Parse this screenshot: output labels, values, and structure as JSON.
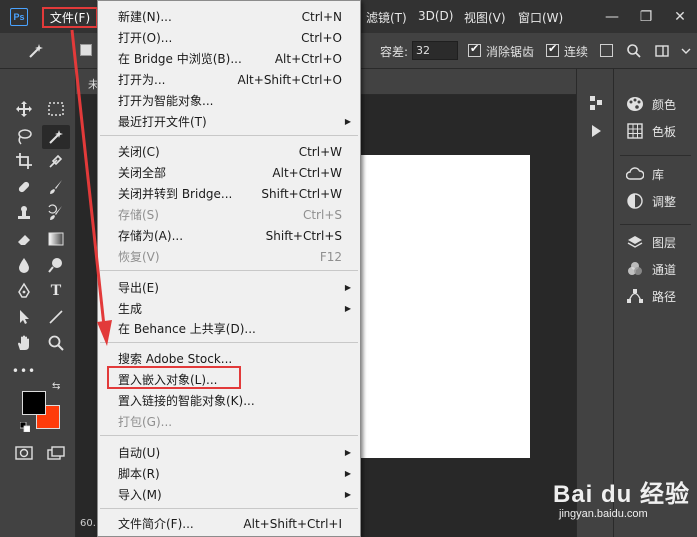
{
  "app": {
    "logo": "Ps"
  },
  "menubar": {
    "file": "文件(F)",
    "filter": "滤镜(T)",
    "three_d": "3D(D)",
    "view": "视图(V)",
    "window": "窗口(W)",
    "win_minimize": "—",
    "win_restore": "❐",
    "win_close": "✕"
  },
  "options": {
    "tolerance_label": "容差:",
    "tolerance_value": "32",
    "antialias_label": "消除锯齿",
    "contiguous_label": "连续"
  },
  "document": {
    "tab_label": "未",
    "zoom": "60."
  },
  "file_menu": {
    "items": [
      {
        "label": "新建(N)...",
        "shortcut": "Ctrl+N"
      },
      {
        "label": "打开(O)...",
        "shortcut": "Ctrl+O"
      },
      {
        "label": "在 Bridge 中浏览(B)...",
        "shortcut": "Alt+Ctrl+O"
      },
      {
        "label": "打开为...",
        "shortcut": "Alt+Shift+Ctrl+O"
      },
      {
        "label": "打开为智能对象...",
        "shortcut": ""
      },
      {
        "label": "最近打开文件(T)",
        "shortcut": "",
        "submenu": true
      },
      {
        "label": "关闭(C)",
        "shortcut": "Ctrl+W"
      },
      {
        "label": "关闭全部",
        "shortcut": "Alt+Ctrl+W"
      },
      {
        "label": "关闭并转到 Bridge...",
        "shortcut": "Shift+Ctrl+W"
      },
      {
        "label": "存储(S)",
        "shortcut": "Ctrl+S",
        "disabled": true
      },
      {
        "label": "存储为(A)...",
        "shortcut": "Shift+Ctrl+S"
      },
      {
        "label": "恢复(V)",
        "shortcut": "F12",
        "disabled": true
      },
      {
        "label": "导出(E)",
        "shortcut": "",
        "submenu": true
      },
      {
        "label": "生成",
        "shortcut": "",
        "submenu": true
      },
      {
        "label": "在 Behance 上共享(D)...",
        "shortcut": ""
      },
      {
        "label": "搜索 Adobe Stock...",
        "shortcut": ""
      },
      {
        "label": "置入嵌入对象(L)...",
        "shortcut": ""
      },
      {
        "label": "置入链接的智能对象(K)...",
        "shortcut": ""
      },
      {
        "label": "打包(G)...",
        "shortcut": "",
        "disabled": true
      },
      {
        "label": "自动(U)",
        "shortcut": "",
        "submenu": true
      },
      {
        "label": "脚本(R)",
        "shortcut": "",
        "submenu": true
      },
      {
        "label": "导入(M)",
        "shortcut": "",
        "submenu": true
      },
      {
        "label": "文件简介(F)...",
        "shortcut": "Alt+Shift+Ctrl+I"
      }
    ]
  },
  "panels": {
    "color": "颜色",
    "swatches": "色板",
    "libraries": "库",
    "adjustments": "调整",
    "layers": "图层",
    "channels": "通道",
    "paths": "路径"
  },
  "colors": {
    "foreground": "#000000",
    "background": "#ff3b0a",
    "annotation_red": "#e23a3a"
  },
  "watermark": {
    "brand": "Bai du 经验",
    "url": "jingyan.baidu.com"
  }
}
